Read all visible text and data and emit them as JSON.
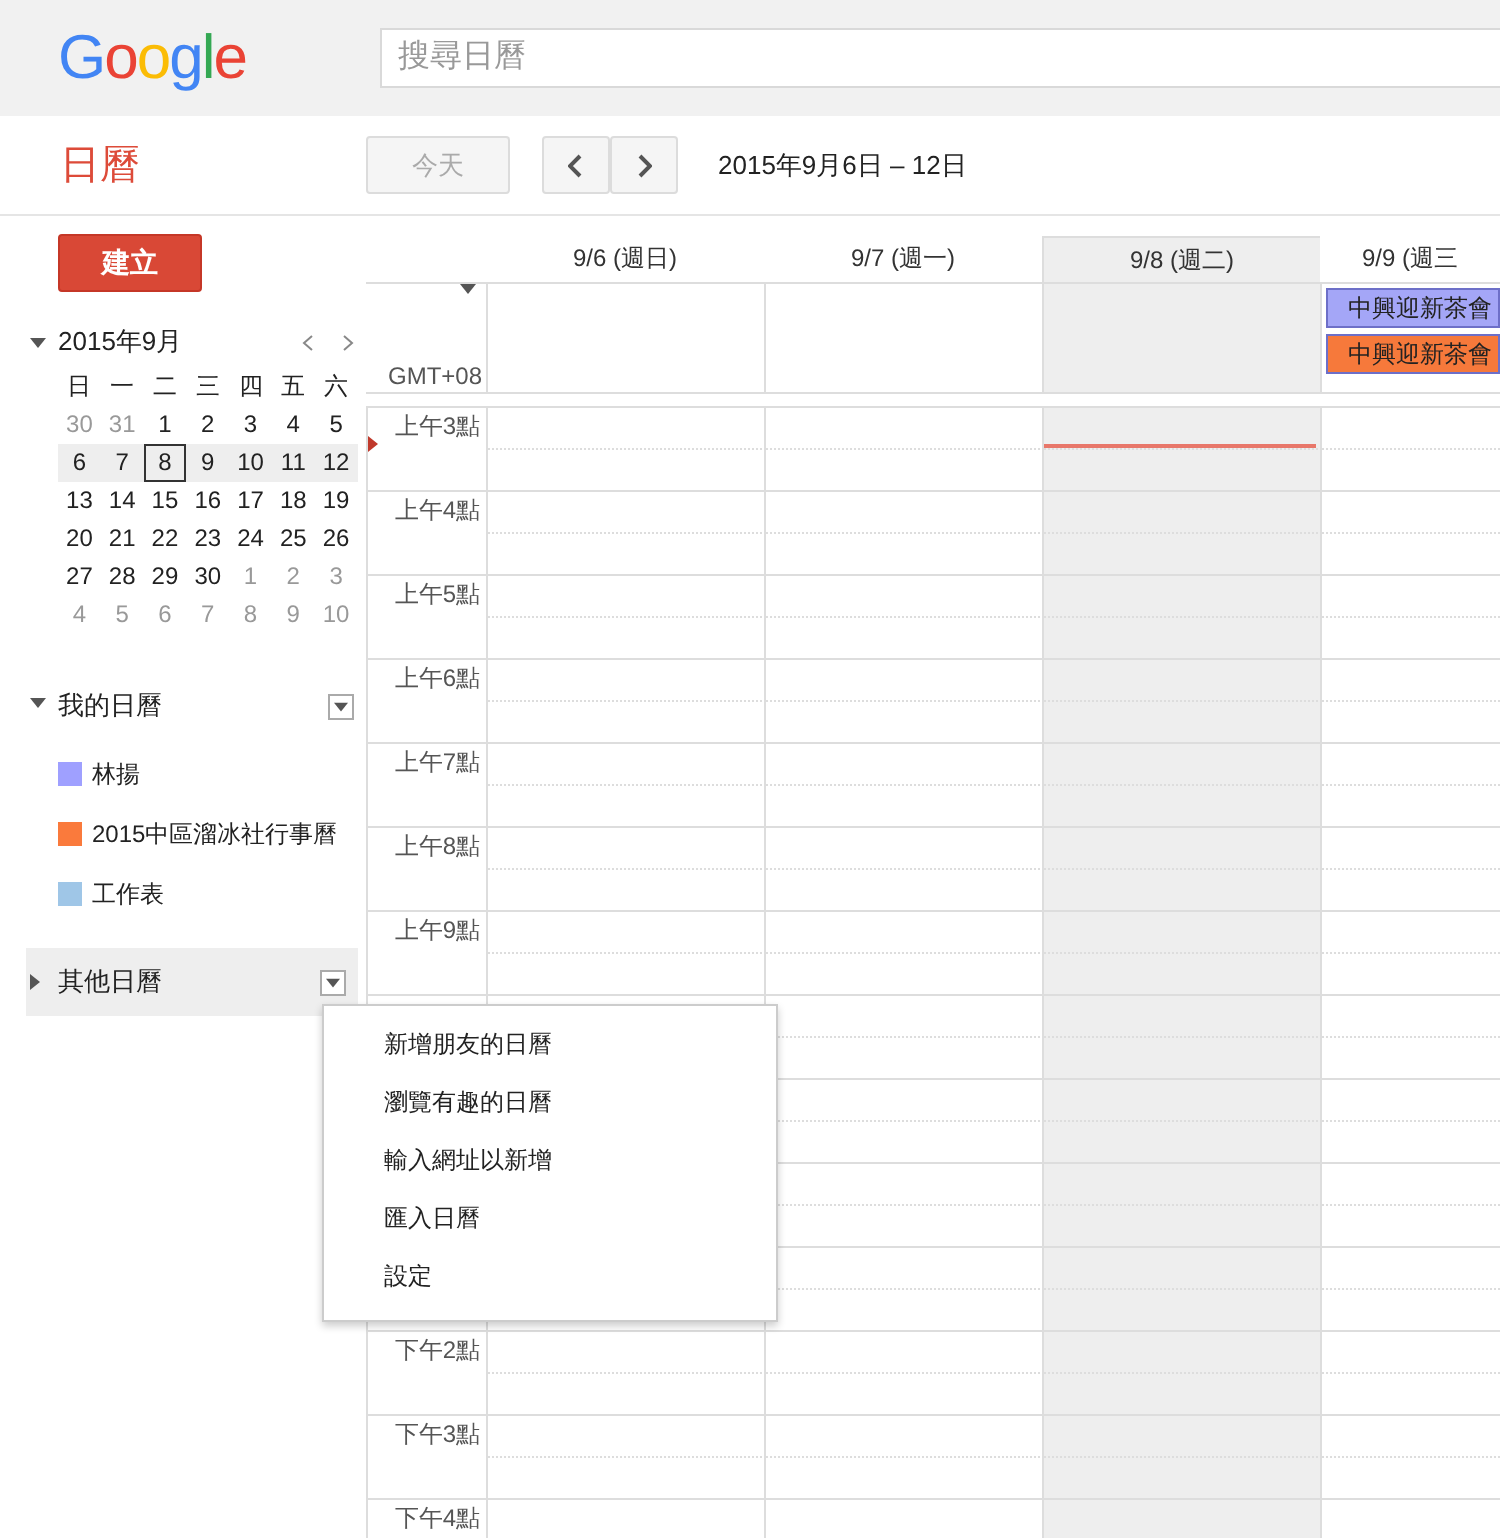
{
  "header": {
    "logo": "Google",
    "search": {
      "placeholder": "搜尋日曆"
    }
  },
  "toolbar": {
    "app_title": "日曆",
    "today_button": {
      "label": "今天",
      "disabled": true
    },
    "date_range": "2015年9月6日 – 12日"
  },
  "create_button": "建立",
  "mini_calendar": {
    "title": "2015年9月",
    "expanded": true,
    "weekdays": [
      "日",
      "一",
      "二",
      "三",
      "四",
      "五",
      "六"
    ],
    "weeks": [
      {
        "selected": false,
        "days": [
          {
            "label": "30",
            "other_month": true,
            "today": false
          },
          {
            "label": "31",
            "other_month": true,
            "today": false
          },
          {
            "label": "1",
            "other_month": false,
            "today": false
          },
          {
            "label": "2",
            "other_month": false,
            "today": false
          },
          {
            "label": "3",
            "other_month": false,
            "today": false
          },
          {
            "label": "4",
            "other_month": false,
            "today": false
          },
          {
            "label": "5",
            "other_month": false,
            "today": false
          }
        ]
      },
      {
        "selected": true,
        "days": [
          {
            "label": "6",
            "other_month": false,
            "today": false
          },
          {
            "label": "7",
            "other_month": false,
            "today": false
          },
          {
            "label": "8",
            "other_month": false,
            "today": true
          },
          {
            "label": "9",
            "other_month": false,
            "today": false
          },
          {
            "label": "10",
            "other_month": false,
            "today": false
          },
          {
            "label": "11",
            "other_month": false,
            "today": false
          },
          {
            "label": "12",
            "other_month": false,
            "today": false
          }
        ]
      },
      {
        "selected": false,
        "days": [
          {
            "label": "13",
            "other_month": false,
            "today": false
          },
          {
            "label": "14",
            "other_month": false,
            "today": false
          },
          {
            "label": "15",
            "other_month": false,
            "today": false
          },
          {
            "label": "16",
            "other_month": false,
            "today": false
          },
          {
            "label": "17",
            "other_month": false,
            "today": false
          },
          {
            "label": "18",
            "other_month": false,
            "today": false
          },
          {
            "label": "19",
            "other_month": false,
            "today": false
          }
        ]
      },
      {
        "selected": false,
        "days": [
          {
            "label": "20",
            "other_month": false,
            "today": false
          },
          {
            "label": "21",
            "other_month": false,
            "today": false
          },
          {
            "label": "22",
            "other_month": false,
            "today": false
          },
          {
            "label": "23",
            "other_month": false,
            "today": false
          },
          {
            "label": "24",
            "other_month": false,
            "today": false
          },
          {
            "label": "25",
            "other_month": false,
            "today": false
          },
          {
            "label": "26",
            "other_month": false,
            "today": false
          }
        ]
      },
      {
        "selected": false,
        "days": [
          {
            "label": "27",
            "other_month": false,
            "today": false
          },
          {
            "label": "28",
            "other_month": false,
            "today": false
          },
          {
            "label": "29",
            "other_month": false,
            "today": false
          },
          {
            "label": "30",
            "other_month": false,
            "today": false
          },
          {
            "label": "1",
            "other_month": true,
            "today": false
          },
          {
            "label": "2",
            "other_month": true,
            "today": false
          },
          {
            "label": "3",
            "other_month": true,
            "today": false
          }
        ]
      },
      {
        "selected": false,
        "days": [
          {
            "label": "4",
            "other_month": true,
            "today": false
          },
          {
            "label": "5",
            "other_month": true,
            "today": false
          },
          {
            "label": "6",
            "other_month": true,
            "today": false
          },
          {
            "label": "7",
            "other_month": true,
            "today": false
          },
          {
            "label": "8",
            "other_month": true,
            "today": false
          },
          {
            "label": "9",
            "other_month": true,
            "today": false
          },
          {
            "label": "10",
            "other_month": true,
            "today": false
          }
        ]
      }
    ]
  },
  "my_calendars": {
    "title": "我的日曆",
    "expanded": true,
    "items": [
      {
        "name": "林揚",
        "color": "#9fa0ff"
      },
      {
        "name": "2015中區溜冰社行事曆",
        "color": "#fa7a3c"
      },
      {
        "name": "工作表",
        "color": "#9fc6e7"
      }
    ]
  },
  "other_calendars": {
    "title": "其他日曆",
    "expanded": false
  },
  "menu": [
    "新增朋友的日曆",
    "瀏覽有趣的日曆",
    "輸入網址以新增",
    "匯入日曆",
    "設定"
  ],
  "week_view": {
    "timezone": "GMT+08",
    "days": [
      {
        "label": "9/6 (週日)",
        "today": false
      },
      {
        "label": "9/7 (週一)",
        "today": false
      },
      {
        "label": "9/8 (週二)",
        "today": true
      },
      {
        "label": "9/9 (週三",
        "today": false,
        "events": [
          {
            "title": "中興迎新茶會",
            "color": "#a4a6f7"
          },
          {
            "title": "中興迎新茶會",
            "color": "#f6793b"
          }
        ]
      }
    ],
    "hours_above_menu": [
      "上午3點",
      "上午4點",
      "上午5點",
      "上午6點",
      "上午7點",
      "上午8點",
      "上午9點"
    ],
    "hours_below_menu": [
      "下午2點",
      "下午3點",
      "下午4點"
    ]
  }
}
